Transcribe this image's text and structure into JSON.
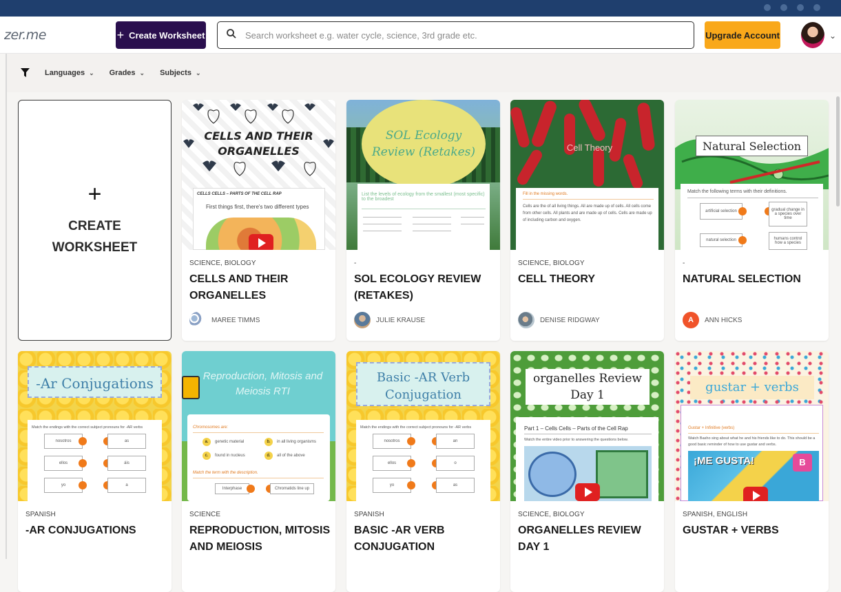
{
  "app": {
    "logo_text": "zer.me"
  },
  "header": {
    "create_label": "Create Worksheet",
    "search_placeholder": "Search worksheet e.g. water cycle, science, 3rd grade etc.",
    "upgrade_label": "Upgrade Account"
  },
  "filters": {
    "items": [
      {
        "label": "Languages"
      },
      {
        "label": "Grades"
      },
      {
        "label": "Subjects"
      }
    ]
  },
  "create_card": {
    "label": "CREATE WORKSHEET"
  },
  "cards": [
    {
      "subjects": "SCIENCE, BIOLOGY",
      "title": "CELLS AND THEIR ORGANELLES",
      "author": "MAREE TIMMS",
      "thumb_title": "CELLS AND THEIR ORGANELLES",
      "thumb_sub": "CELLS CELLS – PARTS OF THE CELL RAP",
      "thumb_text": "First things first, there's two different types"
    },
    {
      "subjects": "-",
      "title": "SOL ECOLOGY REVIEW (RETAKES)",
      "author": "JULIE KRAUSE",
      "thumb_title": "SOL Ecology Review (Retakes)",
      "thumb_text": "List the levels of ecology from the smallest (most specific) to the broadest"
    },
    {
      "subjects": "SCIENCE, BIOLOGY",
      "title": "CELL THEORY",
      "author": "DENISE RIDGWAY",
      "thumb_title": "Cell Theory",
      "thumb_sub": "Fill in the missing words.",
      "thumb_text": "Cells are the of all living things. All are made up of cells. All cells come from other cells. All plants and are made up of cells. Cells are made up of including carbon and oxygen."
    },
    {
      "subjects": "-",
      "title": "NATURAL SELECTION",
      "author": "ANN HICKS",
      "author_initial": "A",
      "thumb_title": "Natural Selection",
      "thumb_sub": "Match the following terms with their definitions.",
      "thumb_labels": [
        "artificial selection",
        "gradual change in a species over time",
        "natural selection",
        "humans control how a species"
      ]
    },
    {
      "subjects": "SPANISH",
      "title": "-AR CONJUGATIONS",
      "thumb_title": "-Ar Conjugations",
      "thumb_sub": "Match the endings with the correct subject pronouns for -AR verbs",
      "thumb_labels": [
        "nosotros",
        "as",
        "ellos",
        "áis",
        "yo",
        "a"
      ]
    },
    {
      "subjects": "SCIENCE",
      "title": "REPRODUCTION, MITOSIS AND MEIOSIS",
      "thumb_title": "Reproduction, Mitosis and Meiosis RTI",
      "thumb_sub": "Chromosomes are:",
      "thumb_labels": [
        "genetic material",
        "in all living organisms",
        "found in nucleus",
        "all of the above"
      ],
      "thumb_sub2": "Match the term with the description.",
      "thumb_labels2": [
        "Interphase",
        "Chromatids line up"
      ]
    },
    {
      "subjects": "SPANISH",
      "title": "BASIC -AR VERB CONJUGATION",
      "thumb_title": "Basic -AR Verb Conjugation",
      "thumb_sub": "Match the endings with the correct subject pronouns for -AR verbs",
      "thumb_labels": [
        "nosotros",
        "an",
        "ellos",
        "o",
        "yo",
        "as"
      ]
    },
    {
      "subjects": "SCIENCE, BIOLOGY",
      "title": "ORGANELLES REVIEW DAY 1",
      "thumb_title": "organelles Review Day 1",
      "thumb_sub": "Part 1 – Cells Cells – Parts of the Cell Rap",
      "thumb_text": "Watch the entire video prior to answering the questions below."
    },
    {
      "subjects": "SPANISH, ENGLISH",
      "title": "GUSTAR + VERBS",
      "thumb_title": "gustar + verbs",
      "thumb_sub": "Gustar + Infinitive (verbs)",
      "thumb_text": "Watch Basho sing about what he and his friends like to do. This should be a good basic reminder of how to use gustar and verbs.",
      "thumb_banner": "¡ME GUSTA!"
    }
  ],
  "colors": {
    "brand_dark": "#2a0f4e",
    "upgrade": "#f9a81a",
    "author_badge": "#f0532a"
  }
}
